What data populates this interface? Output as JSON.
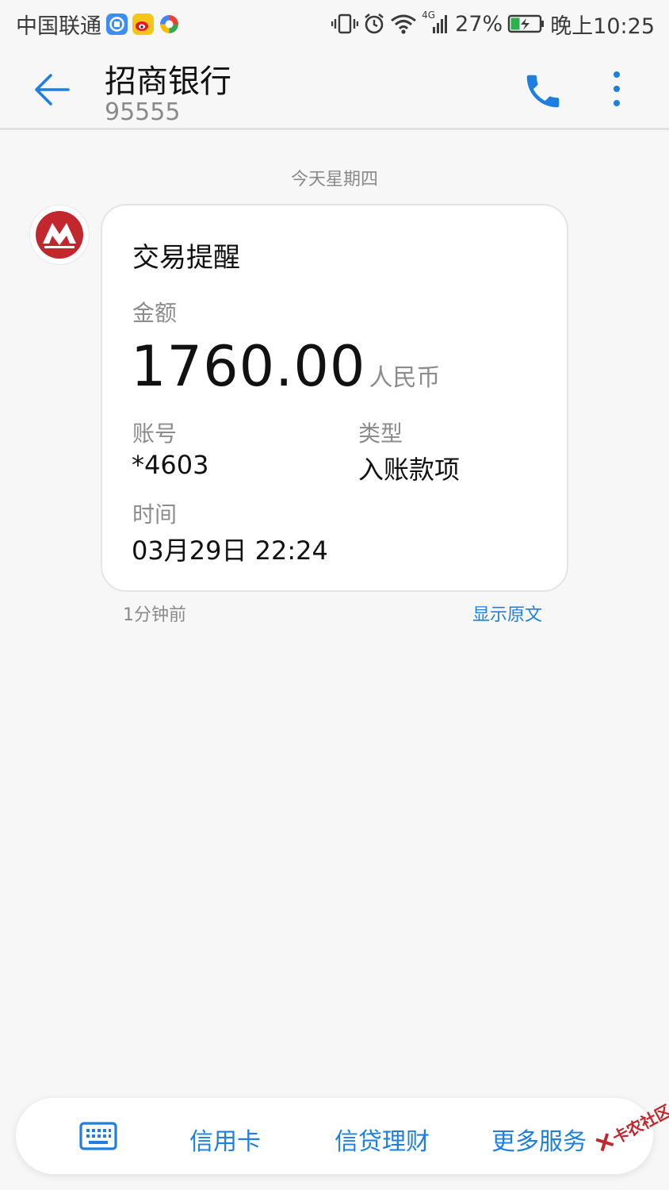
{
  "status_bar": {
    "carrier": "中国联通",
    "app_icons": [
      "browser-app-icon",
      "weibo-app-icon",
      "colorful-app-icon"
    ],
    "network": "4G",
    "battery_percent": "27%",
    "time": "晚上10:25"
  },
  "header": {
    "title": "招商银行",
    "subtitle": "95555"
  },
  "conversation": {
    "date_separator": "今天星期四",
    "message": {
      "card_title": "交易提醒",
      "amount_label": "金额",
      "amount": "1760.00",
      "currency": "人民币",
      "account_label": "账号",
      "account_value": "*4603",
      "type_label": "类型",
      "type_value": "入账款项",
      "time_label": "时间",
      "time_value": "03月29日 22:24",
      "sent_ago": "1分钟前",
      "show_original": "显示原文"
    }
  },
  "menu": {
    "items": [
      "信用卡",
      "信贷理财",
      "更多服务"
    ]
  },
  "watermark": {
    "text": "卡农社区"
  },
  "colors": {
    "accent": "#1f7fe0",
    "brand_red": "#c1272d",
    "background": "#f7f7f7"
  }
}
